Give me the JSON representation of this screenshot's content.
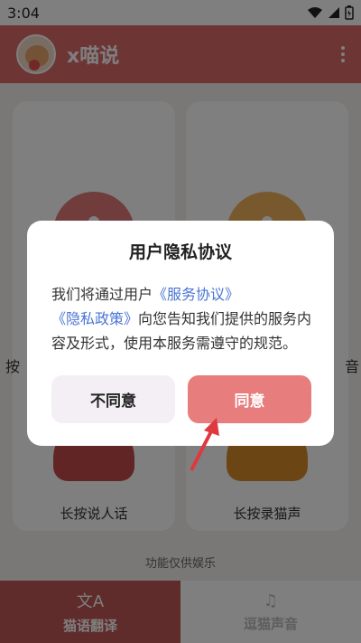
{
  "status": {
    "time": "3:04"
  },
  "app": {
    "title": "x喵说"
  },
  "cards": [
    {
      "side_char": "按",
      "hint": "长按说人话",
      "color": "#e07878"
    },
    {
      "side_char": "音",
      "hint": "长按录猫声",
      "color": "#f0b05a"
    }
  ],
  "footer_note": "功能仅供娱乐",
  "nav": [
    {
      "label": "猫语翻译",
      "icon": "translate-icon"
    },
    {
      "label": "逗猫声音",
      "icon": "music-note-icon"
    }
  ],
  "dialog": {
    "title": "用户隐私协议",
    "body_prefix": "我们将通过用户",
    "link_service": "《服务协议》",
    "link_privacy": "《隐私政策》",
    "body_suffix": "向您告知我们提供的服务内容及形式，使用本服务需遵守的规范。",
    "decline_label": "不同意",
    "agree_label": "同意"
  },
  "colors": {
    "accent": "#dd6a6a",
    "agree": "#e77d7d",
    "link": "#4a74d4",
    "annotation_arrow": "#e0383f"
  }
}
